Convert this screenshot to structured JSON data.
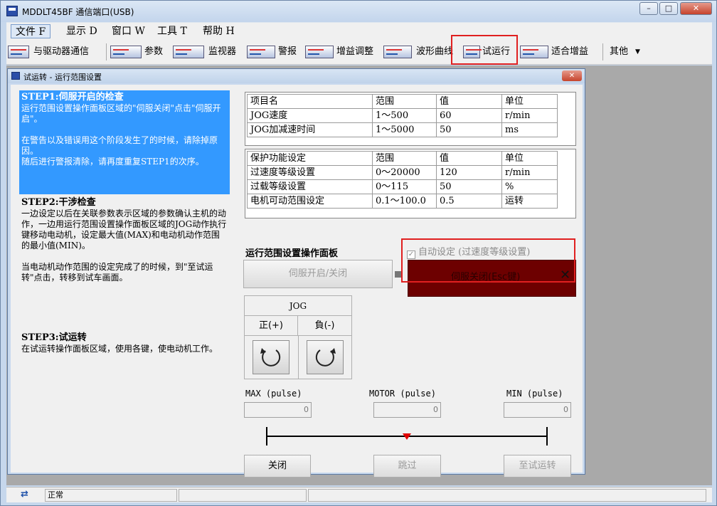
{
  "window": {
    "title": "MDDLT45BF  通信端口(USB)"
  },
  "menu": [
    {
      "label": "文件 F",
      "active": true
    },
    {
      "label": "显示 D"
    },
    {
      "label": "窗口 W"
    },
    {
      "label": "工具 T"
    },
    {
      "label": "帮助 H"
    }
  ],
  "toolbar": {
    "comm": "与驱动器通信",
    "params": "参数",
    "monitor": "监视器",
    "alarm": "警报",
    "gain": "增益调整",
    "waveform": "波形曲线",
    "trial": "试运行",
    "fitgain": "适合增益",
    "other": "其他"
  },
  "dialog": {
    "title": "试运转 - 运行范围设置",
    "close": "✕"
  },
  "steps": {
    "step1_title": "STEP1:伺服开启的检查",
    "step1_p1": "运行范围设置操作面板区域的\"伺服关闭\"点击\"伺服开启\"。",
    "step1_p2": "在警告以及错误用这个阶段发生了的时候，请除掉原因。",
    "step1_p3": "随后进行警报清除，请再度重复STEP1的次序。",
    "step2_title": "STEP2:干涉检查",
    "step2_p1": "一边设定以后在关联参数表示区域的参数确认主机的动作，一边用运行范围设置操作面板区域的JOG动作执行键移动电动机，设定最大值(MAX)和电动机动作范围的最小值(MIN)。",
    "step2_p2": "当电动机动作范围的设定完成了的时候，到\"至试运转\"点击，转移到试车画面。",
    "step3_title": "STEP3:试运转",
    "step3_p1": "在试运转操作面板区域，使用各键，使电动机工作。"
  },
  "table1": {
    "headers": [
      "项目名",
      "范围",
      "值",
      "单位"
    ],
    "rows": [
      [
        "JOG速度",
        "1～500",
        "60",
        "r/min"
      ],
      [
        "JOG加减速时间",
        "1～5000",
        "50",
        "ms"
      ]
    ]
  },
  "table2": {
    "headers": [
      "保护功能设定",
      "范围",
      "值",
      "单位"
    ],
    "rows": [
      [
        "过速度等级设置",
        "0～20000",
        "120",
        "r/min"
      ],
      [
        "过载等级设置",
        "0～115",
        "50",
        "%"
      ],
      [
        "电机可动范围设定",
        "0.1～100.0",
        "0.5",
        "运转"
      ]
    ]
  },
  "panel": {
    "title": "运行范围设置操作面板",
    "auto_set": "自动设定 (过速度等级设置)",
    "auto_check": "✓",
    "servo_on": "伺服开启/关闭",
    "servo_off": "伺服关闭(Esc键)",
    "servo_x": "✕",
    "jog_title": "JOG",
    "jog_plus": "正(+)",
    "jog_minus": "負(-)",
    "max_label": "MAX (pulse)",
    "motor_label": "MOTOR (pulse)",
    "min_label": "MIN (pulse)",
    "max_value": "0",
    "motor_value": "0",
    "min_value": "0",
    "btn_close": "关闭",
    "btn_skip": "跳过",
    "btn_trial": "至试运转"
  },
  "status": {
    "text": "正常",
    "icon": "⇄"
  },
  "colors": {
    "highlight": "#e02020",
    "step1_bg": "#3399ff",
    "servo_off_bg": "#6d0000"
  }
}
